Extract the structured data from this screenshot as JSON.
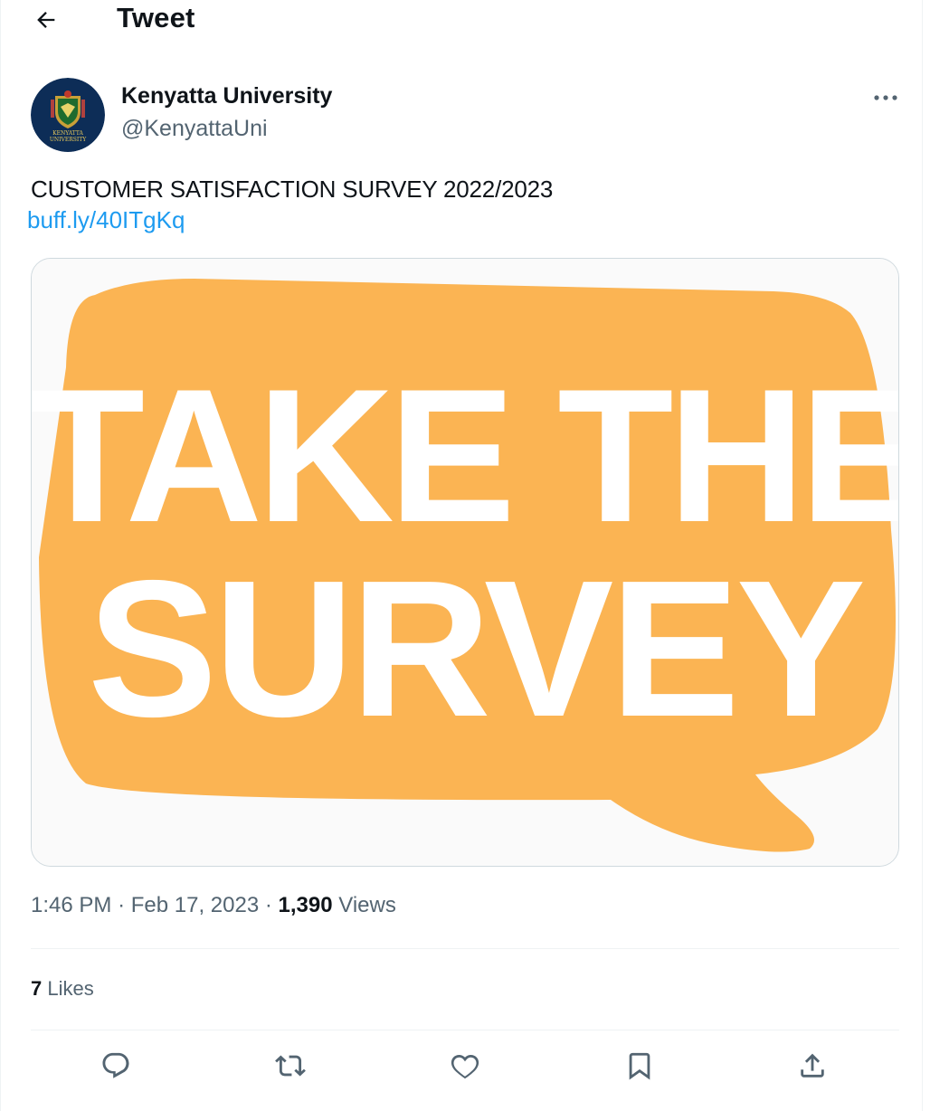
{
  "header": {
    "title": "Tweet"
  },
  "author": {
    "name": "Kenyatta University",
    "handle": "@KenyattaUni",
    "avatar_lines": [
      "KENYATTA",
      "UNIVERSITY"
    ]
  },
  "tweet": {
    "text": "CUSTOMER SATISFACTION SURVEY 2022/2023",
    "link": "buff.ly/40ITgKq",
    "image_text": [
      "TAKE THE",
      "SURVEY"
    ]
  },
  "meta": {
    "time": "1:46 PM",
    "separator": "·",
    "date": "Feb 17, 2023",
    "views_count": "1,390",
    "views_label": "Views"
  },
  "stats": {
    "likes_count": "7",
    "likes_label": "Likes"
  },
  "actions": [
    "reply",
    "retweet",
    "like",
    "bookmark",
    "share"
  ],
  "colors": {
    "accent": "#1d9bf0",
    "bubble": "#fbb453",
    "secondary_text": "#536471"
  }
}
